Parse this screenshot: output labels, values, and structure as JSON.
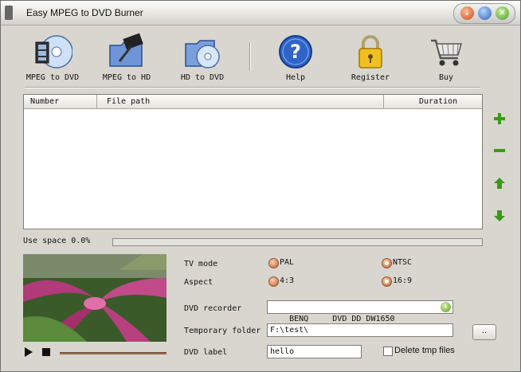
{
  "window": {
    "title": "Easy MPEG to DVD Burner"
  },
  "toolbar": {
    "items": [
      {
        "label": "MPEG to DVD",
        "icon": "disc-film-icon"
      },
      {
        "label": "MPEG to HD",
        "icon": "folder-film-icon"
      },
      {
        "label": "HD to DVD",
        "icon": "folder-disc-icon"
      },
      {
        "label": "Help",
        "icon": "help-icon"
      },
      {
        "label": "Register",
        "icon": "padlock-icon"
      },
      {
        "label": "Buy",
        "icon": "cart-icon"
      }
    ]
  },
  "filelist": {
    "columns": [
      "Number",
      "File path",
      "Duration"
    ],
    "rows": []
  },
  "side_buttons": [
    "add-icon",
    "remove-icon",
    "move-up-icon",
    "move-down-icon"
  ],
  "usage": {
    "label": "Use space 0.0%",
    "fraction": 0.0
  },
  "settings": {
    "tv_mode_label": "TV mode",
    "tv_mode_options": [
      "PAL",
      "NTSC"
    ],
    "tv_mode_selected": "NTSC",
    "aspect_label": "Aspect",
    "aspect_options": [
      "4:3",
      "16:9"
    ],
    "aspect_selected": "16:9",
    "recorder_label": "DVD recorder",
    "recorder_value": "BENQ     DVD DD DW1650",
    "temp_label": "Temporary folder",
    "temp_value": "F:\\test\\",
    "browse_label": "..",
    "dvd_label_label": "DVD label",
    "dvd_label_value": "hello",
    "delete_tmp_label": "Delete tmp files",
    "delete_tmp_checked": false
  },
  "colors": {
    "accent_green": "#3a9a1a",
    "progress": "#4b7ad6"
  }
}
